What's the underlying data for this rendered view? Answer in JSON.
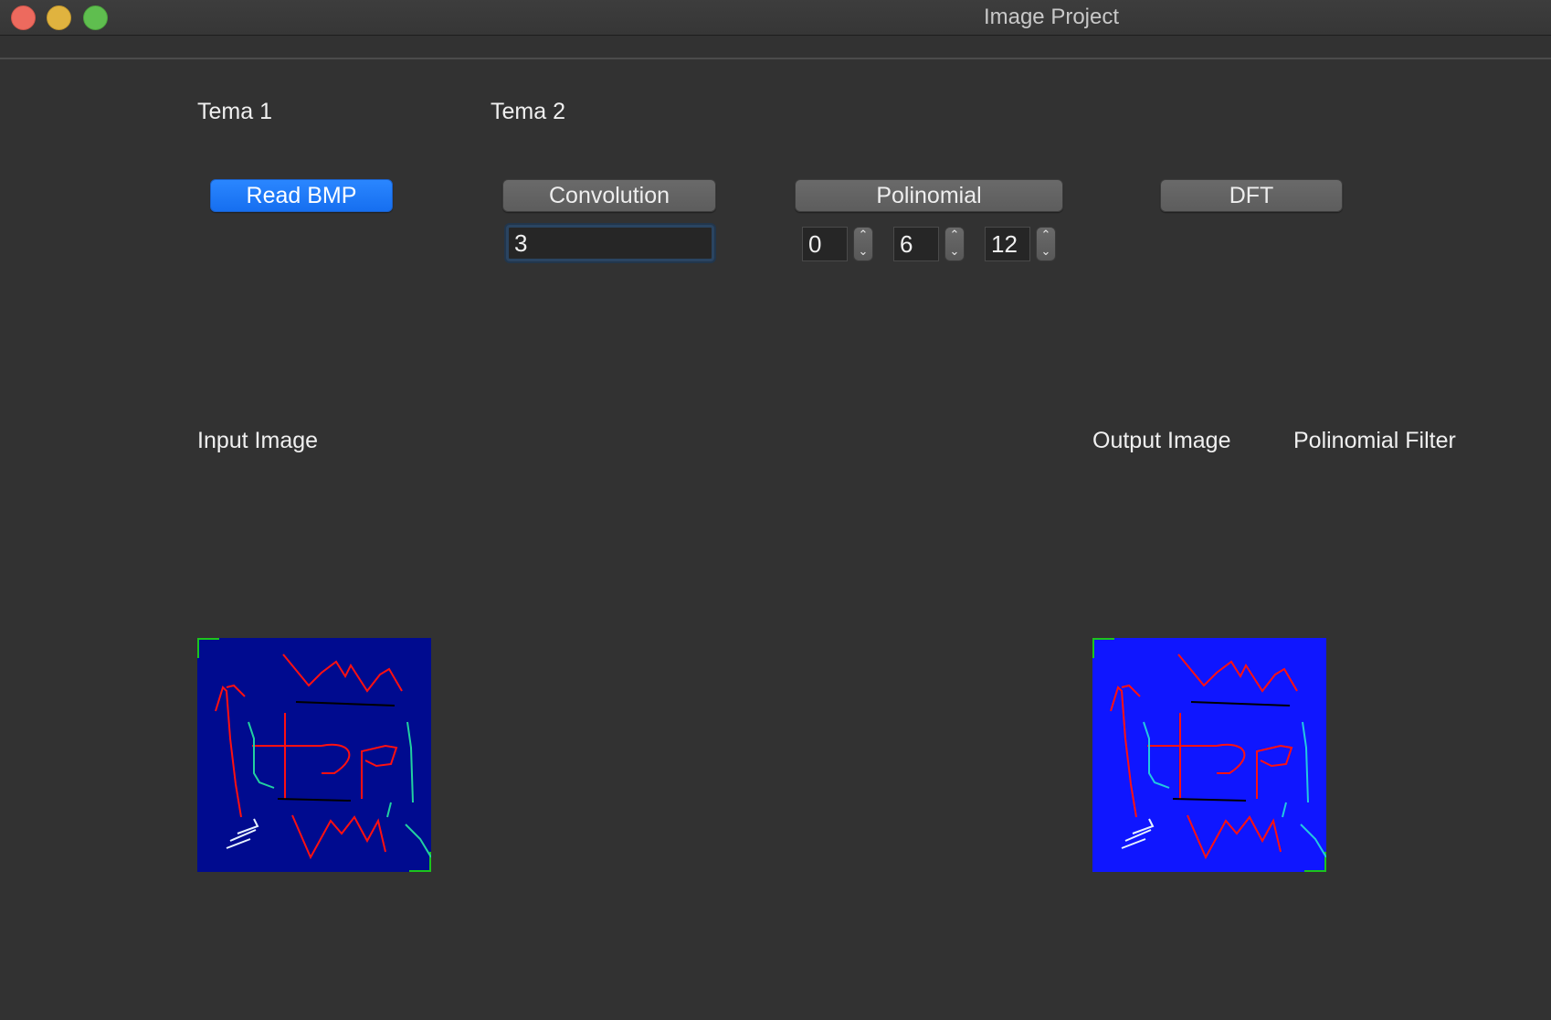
{
  "window": {
    "title": "Image Project"
  },
  "tabs": [
    {
      "label": "Tema 1"
    },
    {
      "label": "Tema 2"
    }
  ],
  "buttons": {
    "read_bmp": "Read BMP",
    "convolution": "Convolution",
    "polinomial": "Polinomial",
    "dft": "DFT"
  },
  "convolution_input": {
    "value": "3"
  },
  "polinomial_inputs": [
    {
      "value": "0"
    },
    {
      "value": "6"
    },
    {
      "value": "12"
    }
  ],
  "stepper_glyphs": {
    "up": "⌃",
    "down": "⌄"
  },
  "panels": {
    "input_label": "Input Image",
    "output_label": "Output Image",
    "filter_label": "Polinomial Filter"
  },
  "colors": {
    "window_bg": "#323232",
    "accent": "#1a75ff",
    "input_image_bg": "#000b8f",
    "output_image_bg": "#0f16ff"
  },
  "icons": {
    "close": "traffic-close-icon",
    "minimize": "traffic-minimize-icon",
    "maximize": "traffic-maximize-icon",
    "stepper": "stepper-chevrons-icon"
  }
}
